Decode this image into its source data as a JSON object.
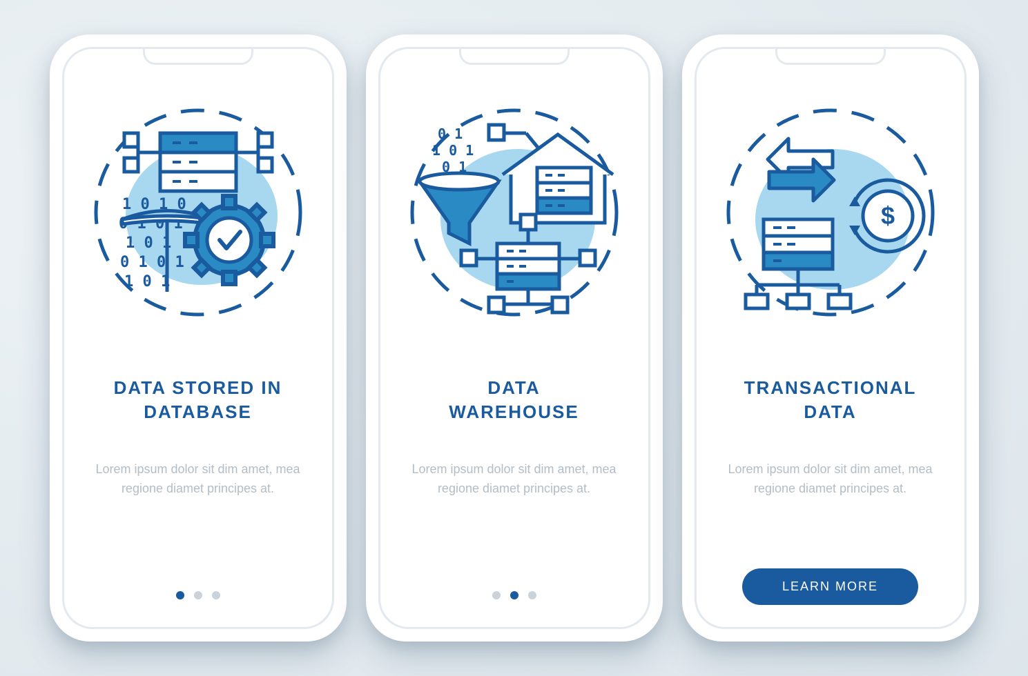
{
  "colors": {
    "primary": "#1a5a9e",
    "accent_light": "#a7d8f0",
    "accent_mid": "#2a8ac4",
    "stroke": "#1a5a9e",
    "body_text": "#b3bdc6",
    "dot_inactive": "#c9d3db"
  },
  "screens": [
    {
      "icon_name": "database-mining-gear-icon",
      "title": "DATA STORED IN\nDATABASE",
      "body": "Lorem ipsum dolor sit dim amet, mea regione diamet principes at.",
      "pager_active_index": 0,
      "has_button": false
    },
    {
      "icon_name": "data-warehouse-funnel-icon",
      "title": "DATA\nWAREHOUSE",
      "body": "Lorem ipsum dolor sit dim amet, mea regione diamet principes at.",
      "pager_active_index": 1,
      "has_button": false
    },
    {
      "icon_name": "transactional-data-exchange-icon",
      "title": "TRANSACTIONAL\nDATA",
      "body": "Lorem ipsum dolor sit dim amet, mea regione diamet principes at.",
      "pager_active_index": 2,
      "has_button": true
    }
  ],
  "cta_label": "LEARN MORE",
  "pager_total": 3
}
